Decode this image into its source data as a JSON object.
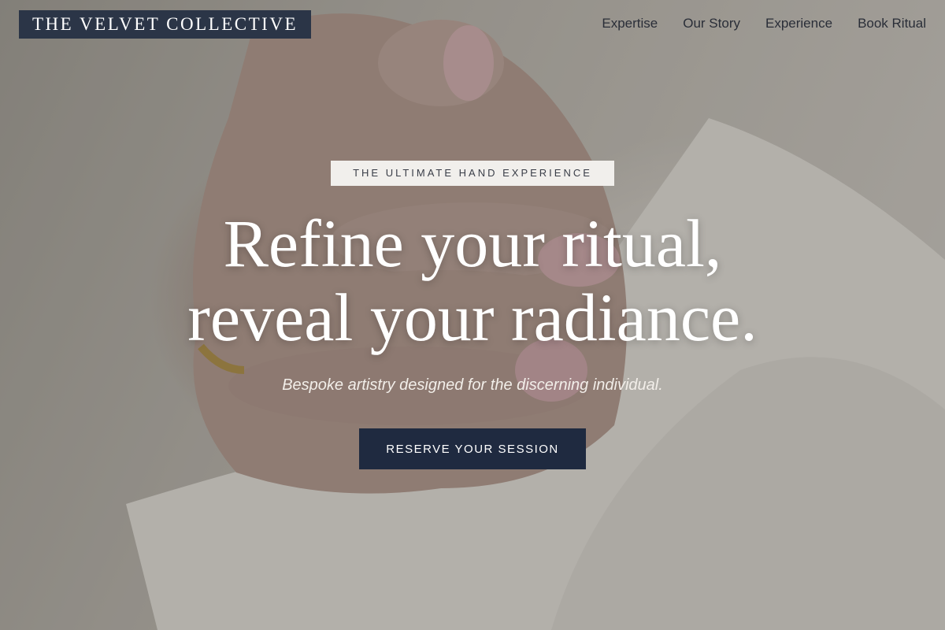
{
  "brand": {
    "name": "THE VELVET COLLECTIVE",
    "background_color": "#2b3547"
  },
  "nav": {
    "items": [
      {
        "label": "Expertise"
      },
      {
        "label": "Our Story"
      },
      {
        "label": "Experience"
      },
      {
        "label": "Book Ritual"
      }
    ]
  },
  "hero": {
    "eyebrow": "THE ULTIMATE HAND EXPERIENCE",
    "headline_line1": "Refine your ritual,",
    "headline_line2": "reveal your radiance.",
    "subtitle": "Bespoke artistry designed for the discerning individual.",
    "cta_label": "RESERVE YOUR SESSION",
    "cta_color": "#1f2a40",
    "background_image": "hand-with-pink-nails-photo"
  }
}
